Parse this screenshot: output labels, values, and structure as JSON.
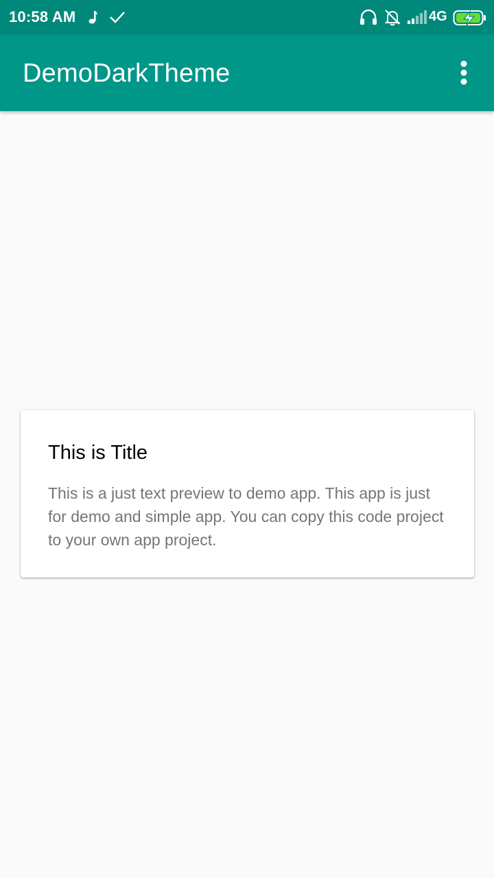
{
  "status_bar": {
    "time": "10:58 AM",
    "network": "4G",
    "icons": [
      "music-note-icon",
      "check-icon",
      "headset-icon",
      "notifications-off-icon",
      "signal-icon",
      "battery-charging-icon"
    ]
  },
  "app_bar": {
    "title": "DemoDarkTheme",
    "overflow_icon": "more-vert-icon"
  },
  "card": {
    "title": "This is Title",
    "body": "This is a just text preview to demo app. This app is just for demo and simple app. You can copy this code project to your own app project."
  },
  "colors": {
    "status_bar": "#00897b",
    "primary": "#009688",
    "background": "#fafafa",
    "card": "#ffffff",
    "body_text": "#757575",
    "battery_fill": "#66dd33"
  }
}
